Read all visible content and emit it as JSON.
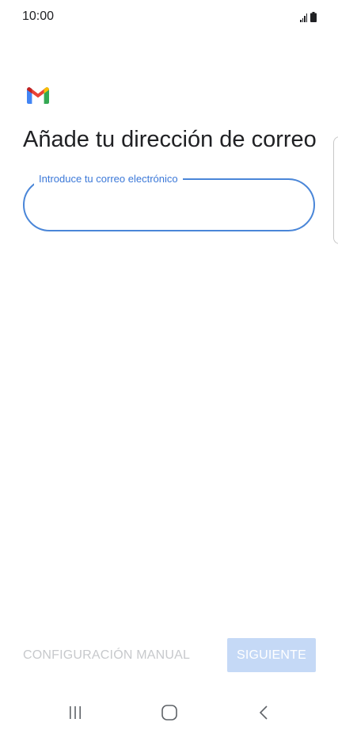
{
  "status_bar": {
    "time": "10:00",
    "signal_icon": "signal-icon",
    "battery_icon": "battery-icon"
  },
  "app": {
    "logo_icon": "gmail-logo-icon"
  },
  "page": {
    "title": "Añade tu dirección de correo"
  },
  "email_field": {
    "label": "Introduce tu correo electrónico",
    "value": ""
  },
  "actions": {
    "manual_config_label": "CONFIGURACIÓN MANUAL",
    "next_label": "SIGUIENTE"
  },
  "nav_bar": {
    "recent_icon": "recent-apps-icon",
    "home_icon": "home-icon",
    "back_icon": "back-icon"
  },
  "colors": {
    "accent": "#4a86d8",
    "label": "#3b78d8",
    "disabled_button_bg": "#c5d9f6",
    "disabled_text": "#c7c9cc",
    "text": "#202124",
    "gmail_red": "#ea4335",
    "gmail_blue": "#4285f4",
    "gmail_green": "#34a853",
    "gmail_yellow": "#fbbc04",
    "gmail_dark_red": "#c5221f"
  }
}
